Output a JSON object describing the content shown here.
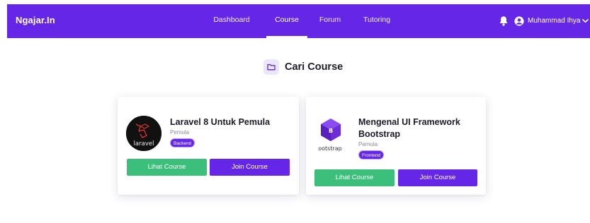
{
  "brand": "Ngajar.In",
  "nav": {
    "items": [
      "Dashboard",
      "Course",
      "Forum",
      "Tutoring"
    ],
    "active": "Course"
  },
  "user": {
    "name": "Muhammad Ihya"
  },
  "icons": {
    "notification": "bell-icon",
    "account": "user-circle-icon",
    "menu": "chevron-down-icon",
    "title": "folder-icon"
  },
  "page": {
    "title": "Cari Course"
  },
  "courses": [
    {
      "title": "Laravel 8 Untuk Pemula",
      "level": "Pemula",
      "tag": "Backend",
      "thumb_text": "laravel",
      "view_label": "Lihat Course",
      "join_label": "Join Course"
    },
    {
      "title": "Mengenal UI Framework Bootstrap",
      "level": "Pemula",
      "tag": "Frontend",
      "thumb_text": "ootstrap",
      "view_label": "Lihat Course",
      "join_label": "Join Course"
    }
  ],
  "colors": {
    "primary": "#6526e8",
    "success": "#3bbf7a",
    "text": "#1d1d2c"
  }
}
